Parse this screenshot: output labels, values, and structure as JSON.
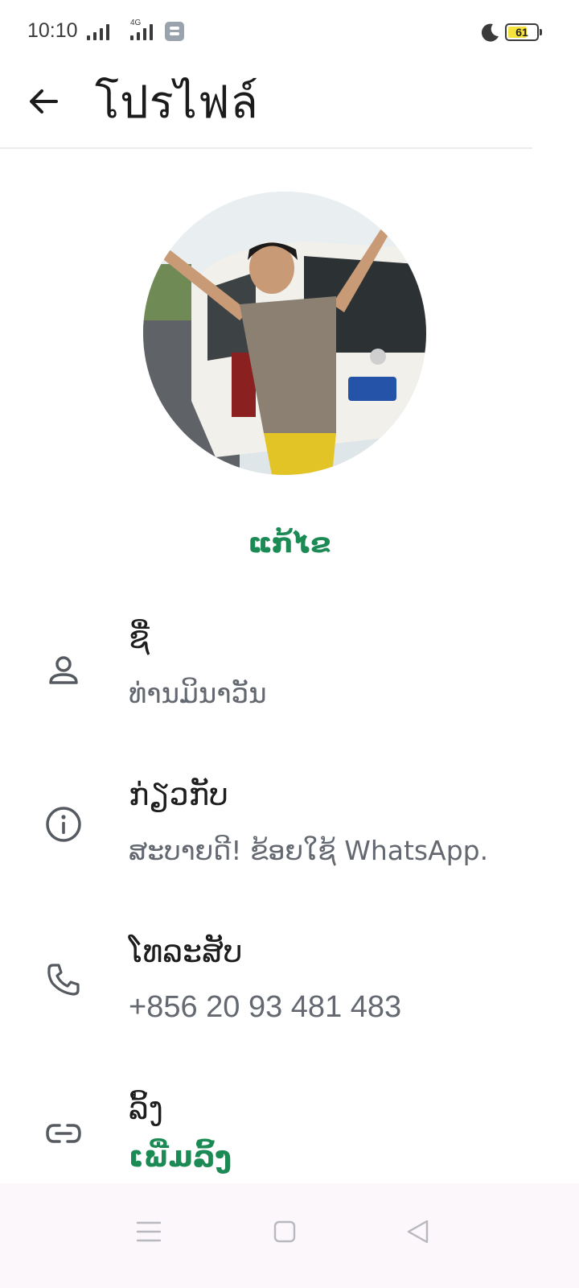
{
  "status_bar": {
    "time": "10:10",
    "network": "4G",
    "battery": "61",
    "battery_level": 0.61
  },
  "header": {
    "title": "โปรไฟล์"
  },
  "profile": {
    "edit_label": "ແກ້ໄຂ"
  },
  "rows": {
    "name": {
      "label": "ຊື່",
      "value": "ທ່ານມິນາວັນ",
      "icon": "person-icon"
    },
    "about": {
      "label": "ກ່ຽວກັບ",
      "value": "ສະບາຍດີ! ຂ້ອຍໃຊ້ WhatsApp.",
      "icon": "info-icon"
    },
    "phone": {
      "label": "ໂທລະສັບ",
      "value": "+856 20 93 481 483",
      "icon": "phone-icon"
    },
    "links": {
      "label": "ລິ້ງ",
      "value": "ເພີ່ມລິ້ງ",
      "icon": "link-icon"
    }
  },
  "colors": {
    "accent": "#1c8a55",
    "secondary_text": "#646870",
    "nav_background": "#fbf7fb"
  }
}
